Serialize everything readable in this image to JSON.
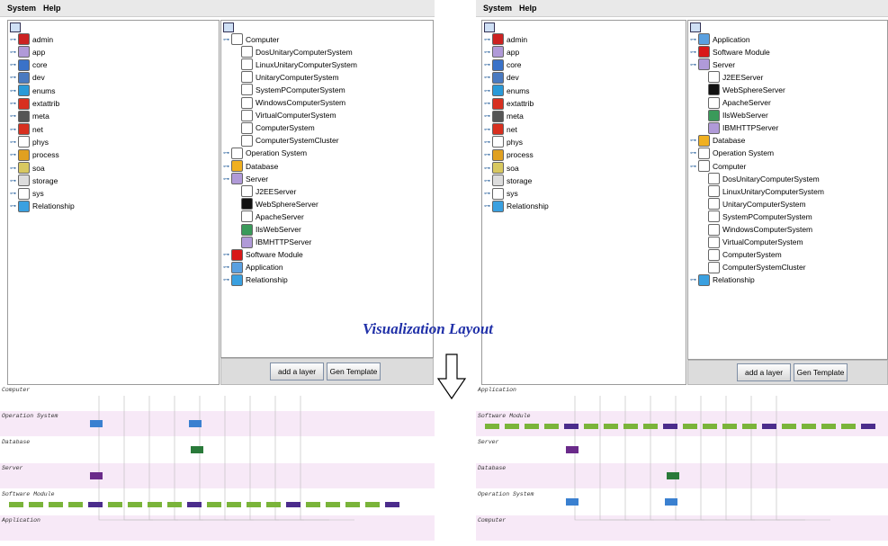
{
  "menu": {
    "system": "System",
    "help": "Help"
  },
  "left_panel": {
    "tree_items": [
      "admin",
      "app",
      "core",
      "dev",
      "enums",
      "extattrib",
      "meta",
      "net",
      "phys",
      "process",
      "soa",
      "storage",
      "sys",
      "Relationship"
    ],
    "class_tree": [
      {
        "label": "Computer",
        "level": 0,
        "icon": "doc-icon"
      },
      {
        "label": "DosUnitaryComputerSystem",
        "level": 1,
        "icon": "doc-icon"
      },
      {
        "label": "LinuxUnitaryComputerSystem",
        "level": 1,
        "icon": "doc-icon"
      },
      {
        "label": "UnitaryComputerSystem",
        "level": 1,
        "icon": "doc-icon"
      },
      {
        "label": "SystemPComputerSystem",
        "level": 1,
        "icon": "doc-icon"
      },
      {
        "label": "WindowsComputerSystem",
        "level": 1,
        "icon": "doc-icon"
      },
      {
        "label": "VirtualComputerSystem",
        "level": 1,
        "icon": "doc-icon"
      },
      {
        "label": "ComputerSystem",
        "level": 1,
        "icon": "doc-icon"
      },
      {
        "label": "ComputerSystemCluster",
        "level": 1,
        "icon": "doc-icon"
      },
      {
        "label": "Operation System",
        "level": 0,
        "icon": "doc-icon"
      },
      {
        "label": "Database",
        "level": 0,
        "icon": "db-icon"
      },
      {
        "label": "Server",
        "level": 0,
        "icon": "gear-icon"
      },
      {
        "label": "J2EEServer",
        "level": 1,
        "icon": "server-icon"
      },
      {
        "label": "WebSphereServer",
        "level": 1,
        "icon": "ws-icon"
      },
      {
        "label": "ApacheServer",
        "level": 1,
        "icon": "server-icon"
      },
      {
        "label": "IlsWebServer",
        "level": 1,
        "icon": "globe-icon"
      },
      {
        "label": "IBMHTTPServer",
        "level": 1,
        "icon": "gear-icon"
      },
      {
        "label": "Software Module",
        "level": 0,
        "icon": "module-icon"
      },
      {
        "label": "Application",
        "level": 0,
        "icon": "app-icon"
      },
      {
        "label": "Relationship",
        "level": 0,
        "icon": "rel-icon"
      }
    ],
    "bands": [
      "Computer",
      "Operation System",
      "Database",
      "Server",
      "Software Module",
      "Application"
    ]
  },
  "right_panel": {
    "tree_items": [
      "admin",
      "app",
      "core",
      "dev",
      "enums",
      "extattrib",
      "meta",
      "net",
      "phys",
      "process",
      "soa",
      "storage",
      "sys",
      "Relationship"
    ],
    "class_tree": [
      {
        "label": "Application",
        "level": 0,
        "icon": "app-icon"
      },
      {
        "label": "Software Module",
        "level": 0,
        "icon": "module-icon"
      },
      {
        "label": "Server",
        "level": 0,
        "icon": "gear-icon"
      },
      {
        "label": "J2EEServer",
        "level": 1,
        "icon": "server-icon"
      },
      {
        "label": "WebSphereServer",
        "level": 1,
        "icon": "ws-icon"
      },
      {
        "label": "ApacheServer",
        "level": 1,
        "icon": "server-icon"
      },
      {
        "label": "IlsWebServer",
        "level": 1,
        "icon": "globe-icon"
      },
      {
        "label": "IBMHTTPServer",
        "level": 1,
        "icon": "gear-icon"
      },
      {
        "label": "Database",
        "level": 0,
        "icon": "db-icon"
      },
      {
        "label": "Operation System",
        "level": 0,
        "icon": "doc-icon"
      },
      {
        "label": "Computer",
        "level": 0,
        "icon": "doc-icon"
      },
      {
        "label": "DosUnitaryComputerSystem",
        "level": 1,
        "icon": "doc-icon"
      },
      {
        "label": "LinuxUnitaryComputerSystem",
        "level": 1,
        "icon": "doc-icon"
      },
      {
        "label": "UnitaryComputerSystem",
        "level": 1,
        "icon": "doc-icon"
      },
      {
        "label": "SystemPComputerSystem",
        "level": 1,
        "icon": "doc-icon"
      },
      {
        "label": "WindowsComputerSystem",
        "level": 1,
        "icon": "doc-icon"
      },
      {
        "label": "VirtualComputerSystem",
        "level": 1,
        "icon": "doc-icon"
      },
      {
        "label": "ComputerSystem",
        "level": 1,
        "icon": "doc-icon"
      },
      {
        "label": "ComputerSystemCluster",
        "level": 1,
        "icon": "doc-icon"
      },
      {
        "label": "Relationship",
        "level": 0,
        "icon": "rel-icon"
      }
    ],
    "bands": [
      "Application",
      "Software Module",
      "Server",
      "Database",
      "Operation System",
      "Computer"
    ]
  },
  "buttons": {
    "add_layer": "add a layer",
    "gen_template": "Gen Template"
  },
  "center_title": "Visualization Layout",
  "colors": {
    "band_pink": "#f7e9f7",
    "band_white": "#ffffff",
    "title_blue": "#2030a8",
    "chip_green": "#7ab43a",
    "chip_purple": "#4b2c8c",
    "chip_red": "#d9302a"
  },
  "icon_map": {
    "admin": "admin-icon",
    "app": "gear-icon",
    "core": "core-icon",
    "dev": "dev-icon",
    "enums": "enum-icon",
    "extattrib": "red-gear-icon",
    "meta": "meta-icon",
    "net": "red-gear-icon",
    "phys": "doc-icon",
    "process": "process-icon",
    "soa": "soa-icon",
    "storage": "storage-icon",
    "sys": "doc-icon",
    "Relationship": "rel-icon"
  }
}
